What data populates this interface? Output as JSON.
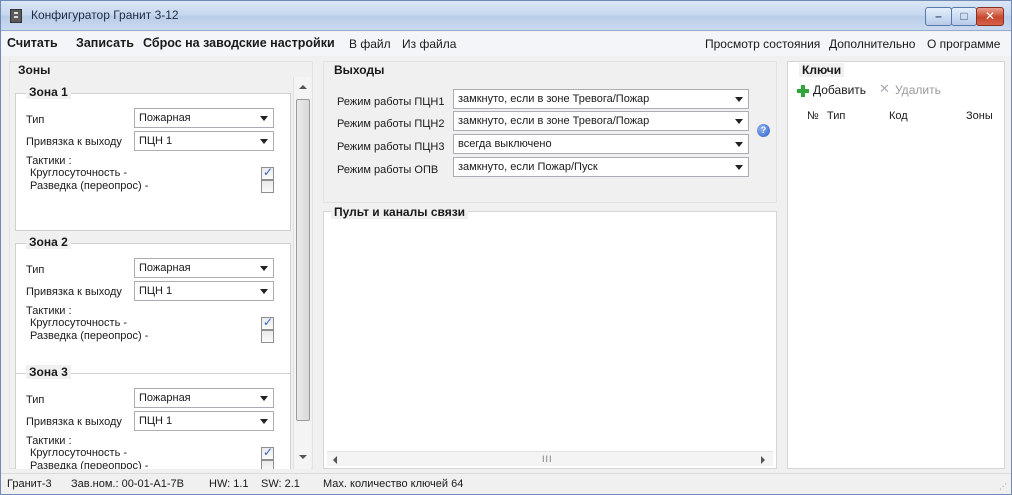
{
  "window": {
    "title": "Конфигуратор Гранит 3-12"
  },
  "menu": {
    "read": "Считать",
    "write": "Записать",
    "reset": "Сброс на заводские настройки",
    "to_file": "В файл",
    "from_file": "Из файла",
    "status_view": "Просмотр состояния",
    "advanced": "Дополнительно",
    "about": "О программе"
  },
  "zones": {
    "title": "Зоны",
    "type_label": "Тип",
    "output_label": "Привязка к выходу",
    "tactics_label": "Тактики :",
    "round_label": "Круглосуточность  -",
    "recon_label": "Разведка (переопрос)  -",
    "items": [
      {
        "title": "Зона 1",
        "type": "Пожарная",
        "output": "ПЦН 1",
        "round": true,
        "recon": false
      },
      {
        "title": "Зона 2",
        "type": "Пожарная",
        "output": "ПЦН 1",
        "round": true,
        "recon": false
      },
      {
        "title": "Зона 3",
        "type": "Пожарная",
        "output": "ПЦН 1",
        "round": true,
        "recon": false
      }
    ]
  },
  "outputs": {
    "title": "Выходы",
    "rows": [
      {
        "label": "Режим работы ПЦН1",
        "value": "замкнуто, если в зоне Тревога/Пожар"
      },
      {
        "label": "Режим работы ПЦН2",
        "value": "замкнуто, если в зоне Тревога/Пожар"
      },
      {
        "label": "Режим работы ПЦН3",
        "value": "всегда выключено"
      },
      {
        "label": "Режим работы ОПВ",
        "value": "замкнуто, если  Пожар/Пуск"
      }
    ]
  },
  "pult": {
    "title": "Пульт и каналы связи",
    "grip": "III"
  },
  "keys": {
    "title": "Ключи",
    "add": "Добавить",
    "delete": "Удалить",
    "columns": [
      "№",
      "Тип",
      "Код",
      "Зоны"
    ]
  },
  "status": {
    "device": "Гранит-3",
    "serial": "Зав.ном.: 00-01-A1-7B",
    "hw": "HW: 1.1",
    "sw": "SW: 2.1",
    "max_keys": "Мах. количество ключей 64"
  },
  "colors": {
    "accent": "#2d5fc8",
    "add_green": "#2fa63b",
    "close_red": "#c8472e"
  }
}
